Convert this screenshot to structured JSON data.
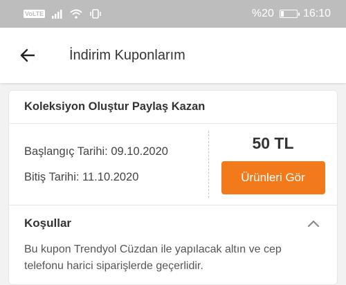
{
  "status_bar": {
    "volte": "VoLTE",
    "battery_text": "%20",
    "battery_level": 0.2,
    "time": "16:10"
  },
  "app_bar": {
    "back_icon": "arrow-left-icon",
    "title": "İndirim Kuponlarım"
  },
  "coupon": {
    "title": "Koleksiyon Oluştur Paylaş Kazan",
    "start_date": "Başlangıç Tarihi: 09.10.2020",
    "end_date": "Bitiş Tarihi: 11.10.2020",
    "amount": "50 TL",
    "button_label": "Ürünleri Gör",
    "conditions_label": "Koşullar",
    "conditions_text": "Bu kupon Trendyol Cüzdan ile yapılacak altın ve cep telefonu harici siparişlerde geçerlidir.",
    "conditions_expanded": true
  },
  "colors": {
    "accent": "#f27a1a",
    "status_bar": "#bdbdbd"
  }
}
